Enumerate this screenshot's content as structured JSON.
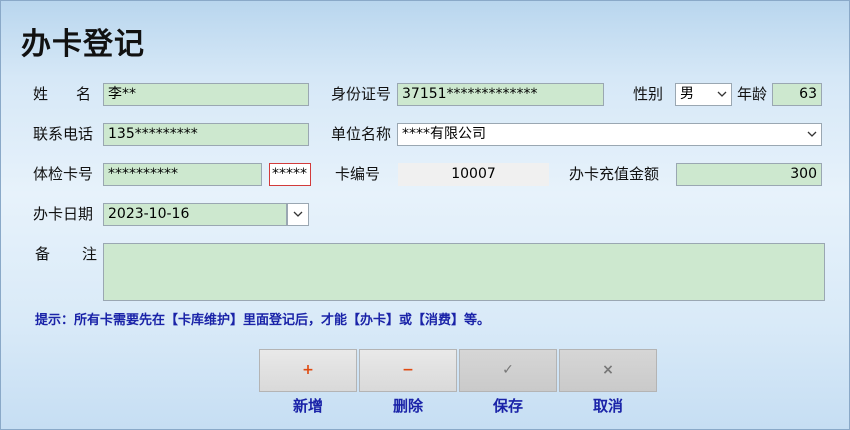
{
  "title": "办卡登记",
  "form": {
    "name_label": "姓名",
    "name_value": "李**",
    "id_label": "身份证号",
    "id_value": "37151*************",
    "gender_label": "性别",
    "gender_value": "男",
    "age_label": "年龄",
    "age_value": "63",
    "phone_label": "联系电话",
    "phone_value": "135*********",
    "unit_label": "单位名称",
    "unit_value": "****有限公司",
    "exam_card_label": "体检卡号",
    "exam_card_value": "**********",
    "password_value": "*****",
    "card_no_label": "卡编号",
    "card_no_value": "10007",
    "recharge_label": "办卡充值金额",
    "recharge_value": "300",
    "date_label": "办卡日期",
    "date_value": "2023-10-16",
    "note_label": "备注",
    "note_value": ""
  },
  "hint": "提示：所有卡需要先在【卡库维护】里面登记后，才能【办卡】或【消费】等。",
  "buttons": {
    "add_icon": "+",
    "add_label": "新增",
    "delete_icon": "−",
    "delete_label": "删除",
    "save_icon": "✓",
    "save_label": "保存",
    "cancel_icon": "×",
    "cancel_label": "取消"
  },
  "icons": {
    "dropdown": "chevron-down-icon"
  },
  "colors": {
    "field_bg": "#cde8cf",
    "hint": "#1a23a8"
  }
}
